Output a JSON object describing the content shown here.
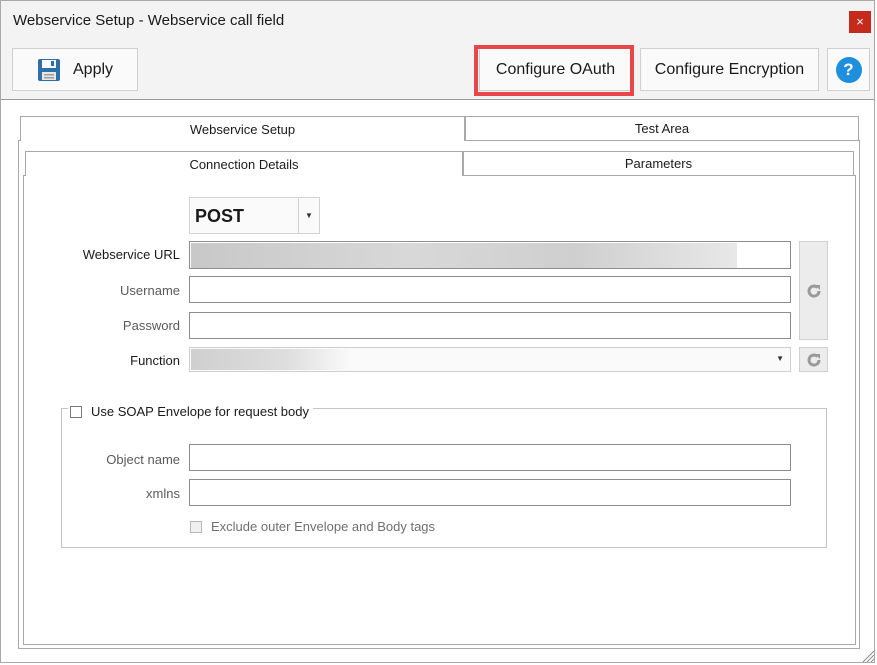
{
  "window": {
    "title": "Webservice Setup - Webservice call field",
    "close_label": "×"
  },
  "toolbar": {
    "apply_label": "Apply",
    "configure_oauth_label": "Configure OAuth",
    "configure_encryption_label": "Configure Encryption",
    "help_label": "?"
  },
  "tabs": [
    {
      "label": "Webservice Setup",
      "active": true
    },
    {
      "label": "Test Area",
      "active": false
    }
  ],
  "subtabs": [
    {
      "label": "Connection Details",
      "active": true
    },
    {
      "label": "Parameters",
      "active": false
    }
  ],
  "form": {
    "method": "POST",
    "webservice_url_label": "Webservice URL",
    "username_label": "Username",
    "username_value": "",
    "password_label": "Password",
    "password_value": "",
    "function_label": "Function",
    "soap": {
      "checkbox_label": "Use SOAP Envelope for request body",
      "checked": false,
      "object_name_label": "Object name",
      "object_name_value": "",
      "xmlns_label": "xmlns",
      "xmlns_value": "",
      "exclude_label": "Exclude outer Envelope and Body tags",
      "exclude_checked": false
    }
  },
  "colors": {
    "highlight": "#e8474a",
    "close": "#c42b1c",
    "help": "#1d8fdc"
  },
  "icons": [
    "save-icon",
    "help-icon",
    "refresh-icon",
    "close-icon",
    "chevron-down-icon",
    "resize-grip-icon"
  ]
}
